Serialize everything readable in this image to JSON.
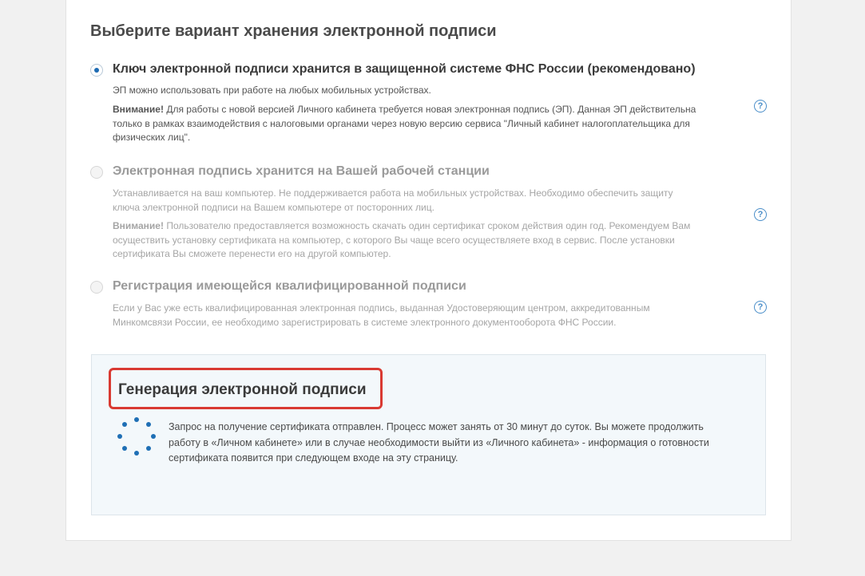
{
  "page": {
    "title": "Выберите вариант хранения электронной подписи"
  },
  "options": [
    {
      "label": "Ключ электронной подписи хранится в защищенной системе ФНС России (рекомендовано)",
      "selected": true,
      "desc": "ЭП можно использовать при работе на любых мобильных устройствах.",
      "warning_title": "Внимание!",
      "warning_line1": " Для работы с новой версией Личного кабинета требуется новая электронная подпись (ЭП). Данная ЭП  действительна",
      "warning_line2": "только в рамках взаимодействия с налоговыми органами через новую версию сервиса  \"Личный кабинет налогоплательщика для",
      "warning_line3": "физических лиц\"."
    },
    {
      "label": "Электронная подпись хранится на Вашей рабочей станции",
      "selected": false,
      "desc_line1": "Устанавливается на ваш компьютер. Не поддерживается работа на мобильных устройствах. Необходимо обеспечить  защиту",
      "desc_line2": "ключа электронной подписи на Вашем компьютере от посторонних лиц.",
      "warning_title": "Внимание!",
      "warning_line1": " Пользователю предоставляется возможность скачать один сертификат  сроком действия один год. Рекомендуем Вам",
      "warning_line2": "осуществить установку сертификата на компьютер, с которого Вы  чаще всего осуществляете вход в сервис. После установки",
      "warning_line3": "сертификата Вы сможете перенести его на другой  компьютер."
    },
    {
      "label": "Регистрация имеющейся квалифицированной подписи",
      "selected": false,
      "desc_line1": "Если у Вас уже есть квалифицированная электронная подпись, выданная Удостоверяющим центром, аккредитованным",
      "desc_line2": "Минкомсвязи России, ее необходимо зарегистрировать в системе электронного документооборота ФНС России."
    }
  ],
  "help": {
    "glyph": "?"
  },
  "generation": {
    "title": "Генерация электронной подписи",
    "line1": "Запрос на получение сертификата отправлен. Процесс может занять от 30 минут до суток. Вы можете продолжить",
    "line2": "работу в «Личном кабинете» или в случае необходимости выйти из «Личного кабинета» - информация о готовности",
    "line3": "сертификата появится при следующем входе на эту страницу."
  },
  "colors": {
    "accent": "#1d6bb3",
    "highlight_border": "#d93a32",
    "panel_bg": "#f3f8fb"
  }
}
